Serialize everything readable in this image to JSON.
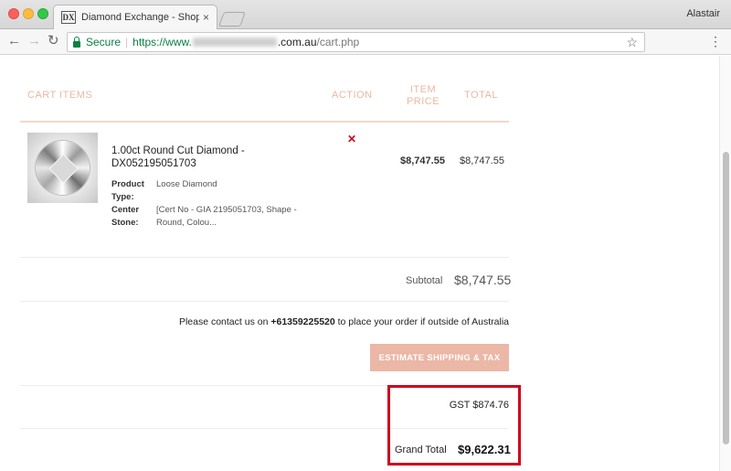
{
  "browser": {
    "tab_favicon": "DX",
    "tab_title": "Diamond Exchange - Shopping",
    "tab_close": "×",
    "profile_name": "Alastair",
    "secure_label": "Secure",
    "url_scheme": "https://www.",
    "url_host_suffix": ".com.au",
    "url_path": "/cart.php",
    "icons": {
      "back": "←",
      "forward": "→",
      "reload": "↻",
      "star": "☆",
      "menu": "⋮"
    }
  },
  "cart": {
    "headers": {
      "items": "CART ITEMS",
      "action": "ACTION",
      "item_price": "ITEM PRICE",
      "total": "TOTAL"
    },
    "item": {
      "name": "1.00ct Round Cut Diamond - DX052195051703",
      "remove_icon": "✕",
      "product_type_label": "Product Type:",
      "product_type_value": "Loose Diamond",
      "center_stone_label": "Center Stone:",
      "center_stone_value": "[Cert No - GIA 2195051703, Shape - Round, Colou...",
      "item_price": "$8,747.55",
      "total": "$8,747.55"
    },
    "subtotal_label": "Subtotal",
    "subtotal_value": "$8,747.55",
    "contact_prefix": "Please contact us on ",
    "contact_phone": "+61359225520",
    "contact_suffix": " to place your order if outside of Australia",
    "ship_button": "ESTIMATE SHIPPING & TAX",
    "gst": "GST $874.76",
    "grand_total_label": "Grand Total",
    "grand_total_value": "$9,622.31"
  },
  "colors": {
    "accent": "#e9b8a3",
    "button": "#ebb7a6",
    "highlight": "#d0021b",
    "remove": "#d0021b",
    "secure": "#0b8043"
  }
}
